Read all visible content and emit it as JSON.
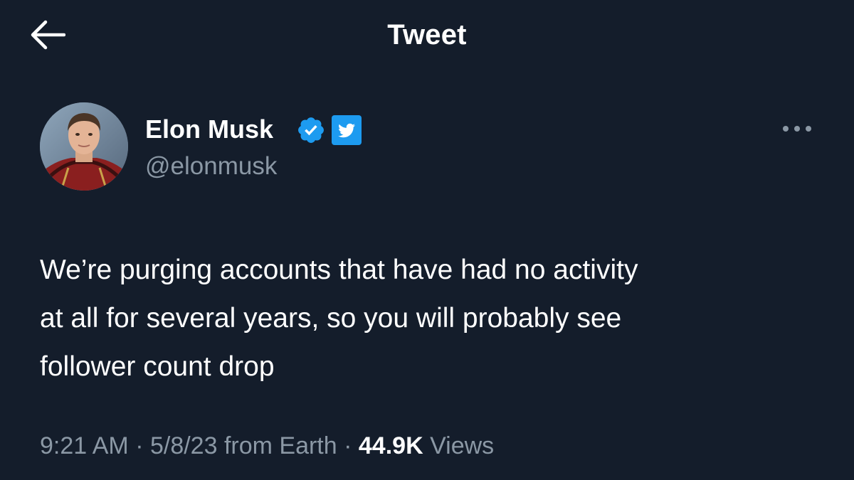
{
  "header": {
    "title": "Tweet",
    "back_icon": "arrow-left-icon"
  },
  "author": {
    "display_name": "Elon Musk",
    "handle": "@elonmusk",
    "verified_badge_icon": "verified-badge-icon",
    "affiliate_badge_icon": "twitter-bird-icon",
    "avatar_icon": "profile-photo"
  },
  "menu": {
    "more_icon": "more-options-icon"
  },
  "tweet": {
    "text_lines": [
      "We’re purging accounts that have had no activity",
      "at all for several years, so you will probably see",
      "follower count drop"
    ]
  },
  "meta": {
    "time": "9:21 AM",
    "sep1": " · ",
    "date": "5/8/23",
    "source": " from Earth",
    "sep2": " · ",
    "views_count": "44.9K",
    "views_label": " Views"
  },
  "colors": {
    "background": "#141d2b",
    "secondary_text": "#8b98a5",
    "accent_blue": "#1d9bf0"
  }
}
